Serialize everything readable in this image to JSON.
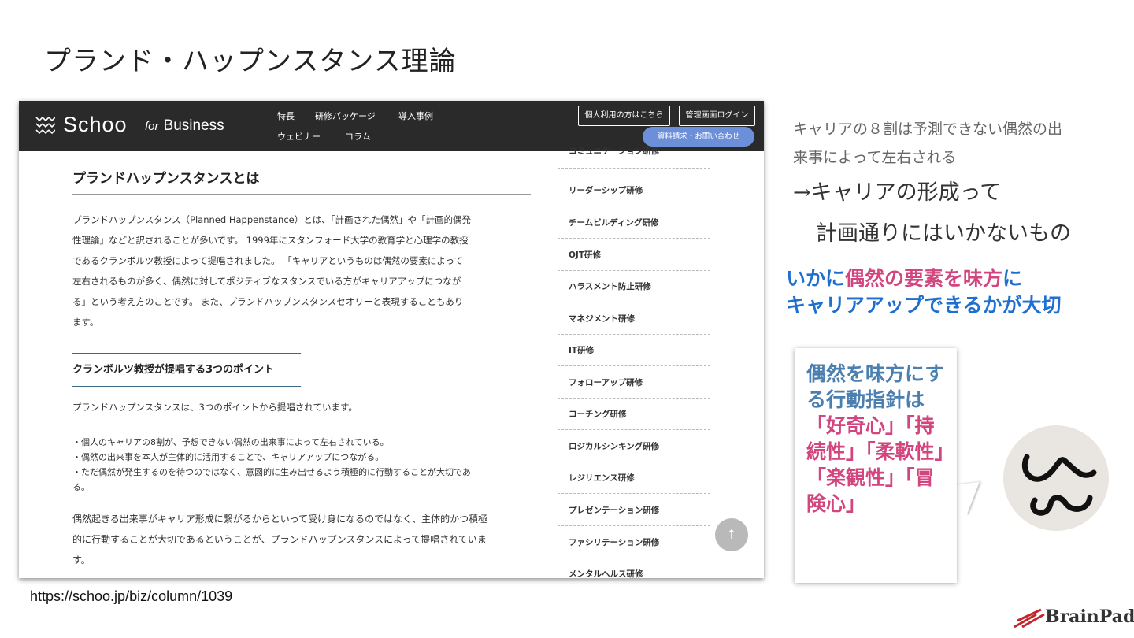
{
  "slide": {
    "title": "プランド・ハップンスタンス理論",
    "source_url": "https://schoo.jp/biz/column/1039"
  },
  "site": {
    "logo_text": "Schoo",
    "logo_for": "for",
    "logo_business": "Business",
    "nav": [
      "特長",
      "研修パッケージ",
      "導入事例",
      "ウェビナー",
      "コラム"
    ],
    "personal_button": "個人利用の方はこちら",
    "admin_login_button": "管理画面ログイン",
    "contact_button": "資料請求・お問い合わせ"
  },
  "article": {
    "heading": "プランドハップンスタンスとは",
    "para1": [
      "プランドハップンスタンス（Planned Happenstance）とは、「計画された偶然」や「計画的偶発",
      "性理論」などと訳されることが多いです。 1999年にスタンフォード大学の教育学と心理学の教授",
      "であるクランボルツ教授によって提唱されました。 「キャリアというものは偶然の要素によって",
      "左右されるものが多く、偶然に対してポジティブなスタンスでいる方がキャリアアップにつなが",
      "る」という考え方のことです。 また、プランドハップンスタンスセオリーと表現することもあり",
      "ます。"
    ],
    "subheading": "クランボルツ教授が提唱する3つのポイント",
    "para2": "プランドハップンスタンスは、3つのポイントから提唱されています。",
    "bullets": [
      "・個人のキャリアの8割が、予想できない偶然の出来事によって左右されている。",
      "・偶然の出来事を本人が主体的に活用することで、キャリアアップにつながる。",
      "・ただ偶然が発生するのを待つのではなく、意図的に生み出せるよう積極的に行動することが大切であ",
      "る。"
    ],
    "para3": [
      "偶然起きる出来事がキャリア形成に繋がるからといって受け身になるのではなく、主体的かつ積極",
      "的に行動することが大切であるということが、プランドハップンスタンスによって提唱されていま",
      "す。"
    ]
  },
  "sidebar": {
    "items": [
      "コミュニケーション研修",
      "リーダーシップ研修",
      "チームビルディング研修",
      "OJT研修",
      "ハラスメント防止研修",
      "マネジメント研修",
      "IT研修",
      "フォローアップ研修",
      "コーチング研修",
      "ロジカルシンキング研修",
      "レジリエンス研修",
      "プレゼンテーション研修",
      "ファシリテーション研修",
      "メンタルヘルス研修"
    ]
  },
  "notes": {
    "line1": "キャリアの８割は予測できない偶然の出",
    "line2": "来事によって左右される",
    "line3": "→キャリアの形成って",
    "line4": "計画通りにはいかないもの",
    "key1a": "いかに",
    "key1b": "偶然の要素を味方",
    "key1c": "に",
    "key2": "キャリアアップできるかが大切"
  },
  "callout": {
    "lead": "偶然を味方にする行動指針は",
    "values": "「好奇心」「持続性」「柔軟性」「楽観性」「冒険心」"
  },
  "brand": {
    "name": "BrainPad"
  },
  "colors": {
    "blue": "#1e6fd0",
    "pink": "#d2457e",
    "callout_blue": "#4a7fb0",
    "nav_bg": "#2a2a2a"
  }
}
